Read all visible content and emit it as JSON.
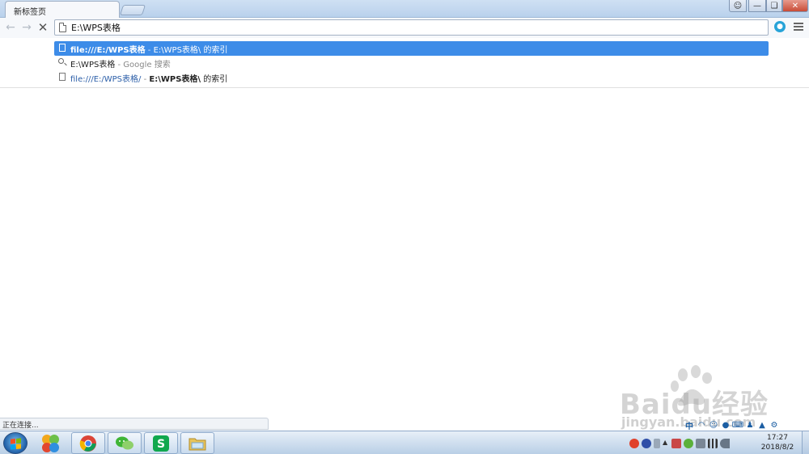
{
  "browser": {
    "tab_title": "新标签页",
    "address_value": "E:\\WPS表格"
  },
  "suggestions": [
    {
      "kind": "file",
      "primary": "file:///E:/WPS表格",
      "separator": " - ",
      "secondary": "E:\\WPS表格\\ 的索引"
    },
    {
      "kind": "search",
      "primary": "E:\\WPS表格",
      "separator": " - ",
      "secondary": "Google 搜索"
    },
    {
      "kind": "file",
      "primary": "file:///E:/WPS表格/",
      "separator": " - ",
      "secondary_bold": "E:\\WPS表格\\",
      "secondary_rest": " 的索引"
    }
  ],
  "status_text": "正在连接...",
  "watermark": {
    "main": "Baidu经验",
    "sub": "jingyan.baidu.com"
  },
  "tray": {
    "ime_label": "中",
    "time": "17:27",
    "date": "2018/8/2"
  },
  "colors": {
    "selected_suggestion": "#3d8ce8",
    "taskbar": "#b9cfe6",
    "extension_badge": "#27a3d8"
  }
}
